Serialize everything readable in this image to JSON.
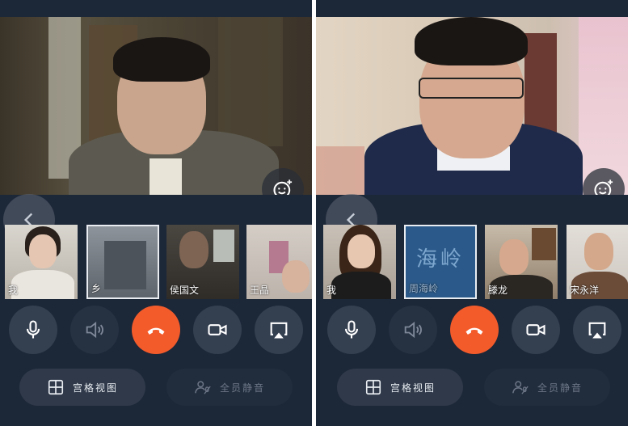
{
  "screens": [
    {
      "participants": [
        {
          "name": "我"
        },
        {
          "name": "乡"
        },
        {
          "name": "侯国文"
        },
        {
          "name": "王晶"
        }
      ],
      "controls": {
        "grid_view_label": "宫格视图",
        "mute_all_label": "全员静音"
      }
    },
    {
      "participants": [
        {
          "name": "我"
        },
        {
          "name": "周海岭",
          "avatar_text": "海岭"
        },
        {
          "name": "滕龙"
        },
        {
          "name": "宋永洋"
        }
      ],
      "controls": {
        "grid_view_label": "宫格视图",
        "mute_all_label": "全员静音"
      }
    }
  ],
  "colors": {
    "background": "#1c2738",
    "hangup": "#f35b2b",
    "button": "#343f50",
    "avatar_tile": "#2b5a8a"
  },
  "icons": [
    "smiley-sticker-icon",
    "chevron-left-icon",
    "microphone-icon",
    "speaker-icon",
    "hangup-icon",
    "camera-icon",
    "airplay-icon",
    "grid-icon",
    "mute-all-icon"
  ]
}
